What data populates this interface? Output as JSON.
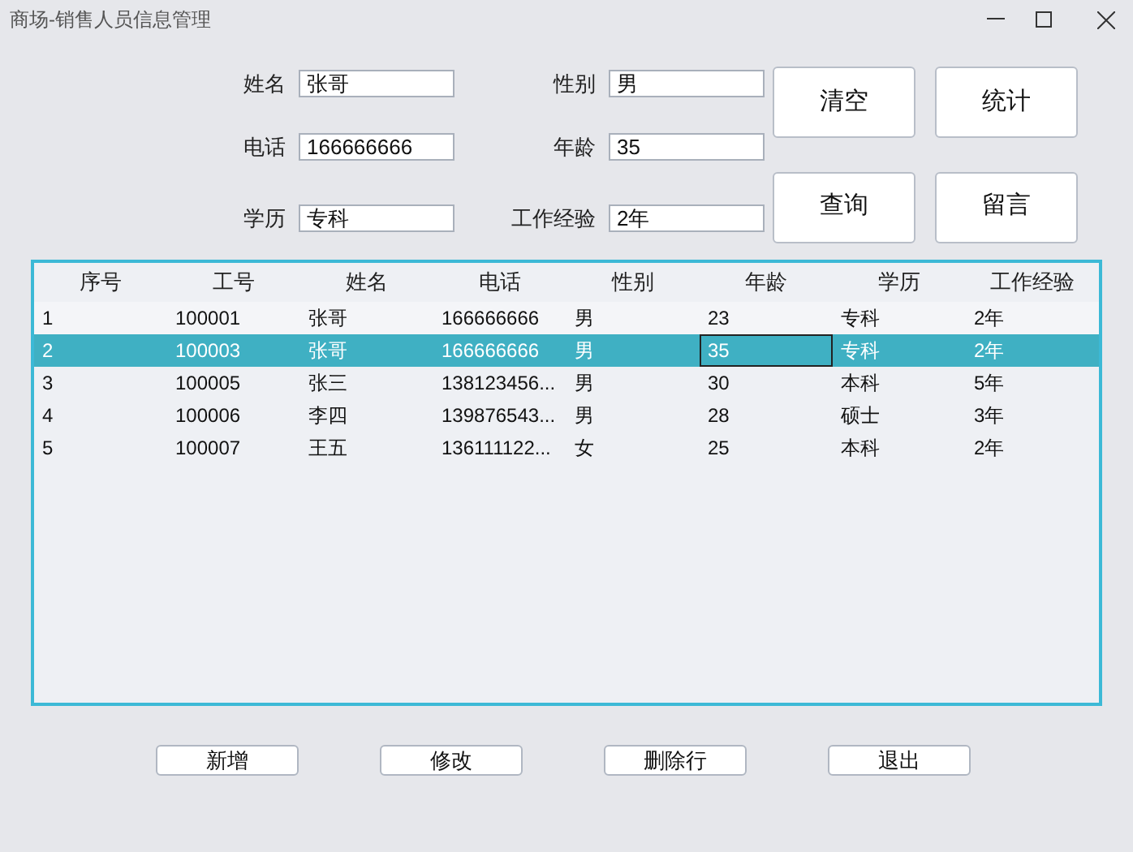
{
  "window": {
    "title": "商场-销售人员信息管理"
  },
  "form": {
    "fields": [
      {
        "label": "姓名",
        "value": "张哥"
      },
      {
        "label": "性别",
        "value": "男"
      },
      {
        "label": "电话",
        "value": "166666666"
      },
      {
        "label": "年龄",
        "value": "35"
      },
      {
        "label": "学历",
        "value": "专科"
      },
      {
        "label": "工作经验",
        "value": "2年"
      }
    ]
  },
  "action_buttons": [
    "清空",
    "统计",
    "查询",
    "留言"
  ],
  "table": {
    "columns": [
      "序号",
      "工号",
      "姓名",
      "电话",
      "性别",
      "年龄",
      "学历",
      "工作经验"
    ],
    "rows": [
      {
        "selected": false,
        "cells": [
          {
            "text": "1",
            "focused": false
          },
          {
            "text": "100001",
            "focused": false
          },
          {
            "text": "张哥",
            "focused": false
          },
          {
            "text": "166666666",
            "focused": false
          },
          {
            "text": "男",
            "focused": false
          },
          {
            "text": "23",
            "focused": false
          },
          {
            "text": "专科",
            "focused": false
          },
          {
            "text": "2年",
            "focused": false
          }
        ]
      },
      {
        "selected": true,
        "cells": [
          {
            "text": "2",
            "focused": false
          },
          {
            "text": "100003",
            "focused": false
          },
          {
            "text": "张哥",
            "focused": false
          },
          {
            "text": "166666666",
            "focused": false
          },
          {
            "text": "男",
            "focused": false
          },
          {
            "text": "35",
            "focused": true
          },
          {
            "text": "专科",
            "focused": false
          },
          {
            "text": "2年",
            "focused": false
          }
        ]
      },
      {
        "selected": false,
        "cells": [
          {
            "text": "3",
            "focused": false
          },
          {
            "text": "100005",
            "focused": false
          },
          {
            "text": "张三",
            "focused": false
          },
          {
            "text": "138123456...",
            "focused": false
          },
          {
            "text": "男",
            "focused": false
          },
          {
            "text": "30",
            "focused": false
          },
          {
            "text": "本科",
            "focused": false
          },
          {
            "text": "5年",
            "focused": false
          }
        ]
      },
      {
        "selected": false,
        "cells": [
          {
            "text": "4",
            "focused": false
          },
          {
            "text": "100006",
            "focused": false
          },
          {
            "text": "李四",
            "focused": false
          },
          {
            "text": "139876543...",
            "focused": false
          },
          {
            "text": "男",
            "focused": false
          },
          {
            "text": "28",
            "focused": false
          },
          {
            "text": "硕士",
            "focused": false
          },
          {
            "text": "3年",
            "focused": false
          }
        ]
      },
      {
        "selected": false,
        "cells": [
          {
            "text": "5",
            "focused": false
          },
          {
            "text": "100007",
            "focused": false
          },
          {
            "text": "王五",
            "focused": false
          },
          {
            "text": "136111122...",
            "focused": false
          },
          {
            "text": "女",
            "focused": false
          },
          {
            "text": "25",
            "focused": false
          },
          {
            "text": "本科",
            "focused": false
          },
          {
            "text": "2年",
            "focused": false
          }
        ]
      }
    ]
  },
  "bottom_buttons": [
    "新增",
    "修改",
    "删除行",
    "退出"
  ]
}
